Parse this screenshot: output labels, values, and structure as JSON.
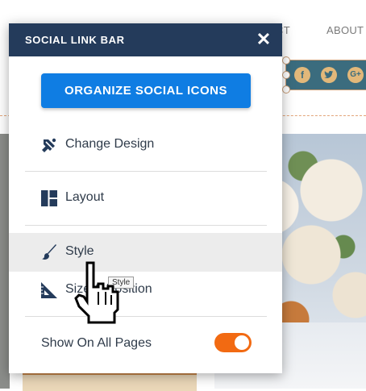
{
  "site": {
    "nav": [
      "CT",
      "ABOUT"
    ],
    "social_icons": [
      "f",
      "twitter-bird",
      "G+"
    ]
  },
  "panel": {
    "title": "SOCIAL LINK BAR",
    "close_symbol": "✕",
    "primary_button": "ORGANIZE SOCIAL ICONS",
    "menu": [
      {
        "label": "Change Design",
        "icon": "paint-roller-icon"
      },
      {
        "label": "Layout",
        "icon": "layout-grid-icon"
      },
      {
        "label": "Style",
        "icon": "paint-brush-icon",
        "active": true
      },
      {
        "label": "Size & Position",
        "icon": "ruler-triangle-icon"
      }
    ],
    "show_all_pages": {
      "label": "Show On All Pages",
      "enabled": true
    }
  },
  "tooltip": "Style",
  "colors": {
    "header_bg": "#243b5b",
    "primary_button": "#0f7de3",
    "toggle_on": "#f26a12",
    "active_row": "#ececec",
    "social_strip": "#3b6c7e"
  }
}
